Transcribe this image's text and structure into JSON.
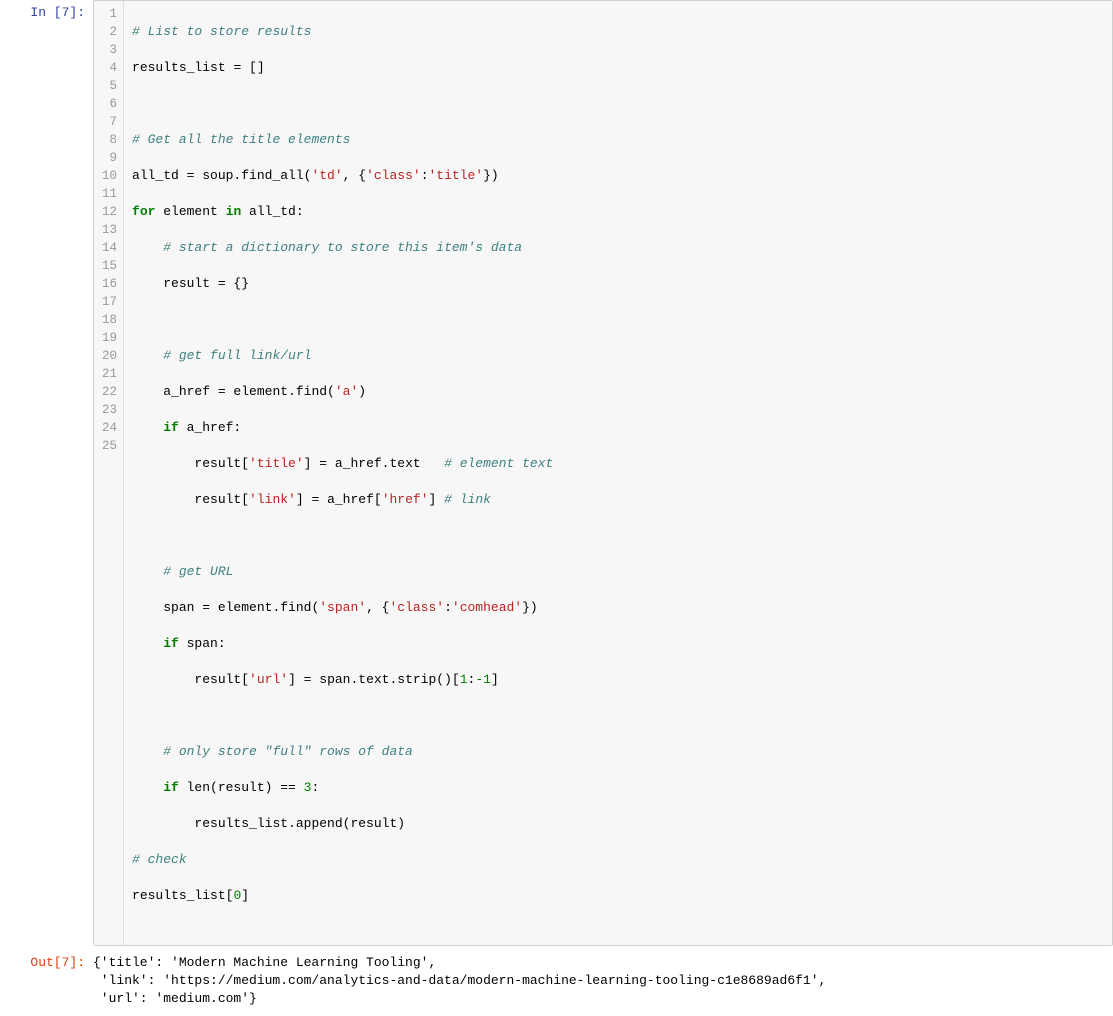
{
  "in_prompt": "In [7]:",
  "out_prompt": "Out[7]:",
  "line_numbers": [
    "1",
    "2",
    "3",
    "4",
    "5",
    "6",
    "7",
    "8",
    "9",
    "10",
    "11",
    "12",
    "13",
    "14",
    "15",
    "16",
    "17",
    "18",
    "19",
    "20",
    "21",
    "22",
    "23",
    "24",
    "25"
  ],
  "code": {
    "l1_comment": "# List to store results",
    "l2_var": "results_list",
    "l2_rest": " = []",
    "l4_comment": "# Get all the title elements",
    "l5_var": "all_td = soup.find_all(",
    "l5_s1": "'td'",
    "l5_mid": ", {",
    "l5_s2": "'class'",
    "l5_colon": ":",
    "l5_s3": "'title'",
    "l5_end": "})",
    "l6_for": "for",
    "l6_el": " element ",
    "l6_in": "in",
    "l6_rest": " all_td:",
    "l7_comment": "    # start a dictionary to store this item's data",
    "l8": "    result = {}",
    "l10_comment": "    # get full link/url",
    "l11_a": "    a_href = element.find(",
    "l11_s": "'a'",
    "l11_e": ")",
    "l12_if": "    if",
    "l12_r": " a_href:",
    "l13_a": "        result[",
    "l13_s1": "'title'",
    "l13_mid": "] = a_href.text   ",
    "l13_c": "# element text",
    "l14_a": "        result[",
    "l14_s1": "'link'",
    "l14_mid": "] = a_href[",
    "l14_s2": "'href'",
    "l14_e": "] ",
    "l14_c": "# link",
    "l16_comment": "    # get URL",
    "l17_a": "    span = element.find(",
    "l17_s1": "'span'",
    "l17_mid": ", {",
    "l17_s2": "'class'",
    "l17_colon": ":",
    "l17_s3": "'comhead'",
    "l17_e": "})",
    "l18_if": "    if",
    "l18_r": " span:",
    "l19_a": "        result[",
    "l19_s1": "'url'",
    "l19_mid": "] = span.text.strip()[",
    "l19_n1": "1",
    "l19_colon": ":",
    "l19_n2": "-1",
    "l19_e": "]",
    "l21_comment": "    # only store \"full\" rows of data",
    "l22_if": "    if",
    "l22_mid": " len(result) == ",
    "l22_n": "3",
    "l22_e": ":",
    "l23": "        results_list.append(result)",
    "l24_comment": "# check",
    "l25_a": "results_list[",
    "l25_n": "0",
    "l25_e": "]"
  },
  "output": {
    "line1": "{'title': 'Modern Machine Learning Tooling',",
    "line2": " 'link': 'https://medium.com/analytics-and-data/modern-machine-learning-tooling-c1e8689ad6f1',",
    "line3": " 'url': 'medium.com'}"
  }
}
